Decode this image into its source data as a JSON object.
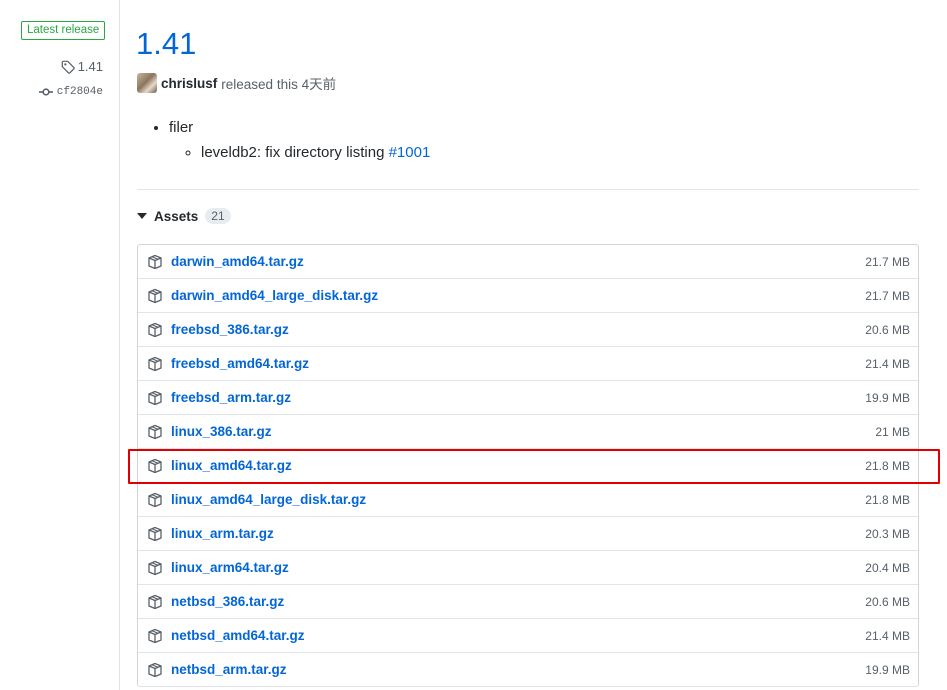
{
  "meta": {
    "latest_badge": "Latest release",
    "tag": "1.41",
    "commit": "cf2804e"
  },
  "release": {
    "title": "1.41",
    "author": "chrislusf",
    "released_text": "released this 4天前"
  },
  "notes": {
    "items": [
      {
        "text": "filer",
        "subitems": [
          {
            "text": "leveldb2: fix directory listing",
            "link": "#1001"
          }
        ]
      }
    ]
  },
  "assets": {
    "label": "Assets",
    "count": "21",
    "items": [
      {
        "name": "darwin_amd64.tar.gz",
        "size": "21.7 MB"
      },
      {
        "name": "darwin_amd64_large_disk.tar.gz",
        "size": "21.7 MB"
      },
      {
        "name": "freebsd_386.tar.gz",
        "size": "20.6 MB"
      },
      {
        "name": "freebsd_amd64.tar.gz",
        "size": "21.4 MB"
      },
      {
        "name": "freebsd_arm.tar.gz",
        "size": "19.9 MB"
      },
      {
        "name": "linux_386.tar.gz",
        "size": "21 MB"
      },
      {
        "name": "linux_amd64.tar.gz",
        "size": "21.8 MB"
      },
      {
        "name": "linux_amd64_large_disk.tar.gz",
        "size": "21.8 MB"
      },
      {
        "name": "linux_arm.tar.gz",
        "size": "20.3 MB"
      },
      {
        "name": "linux_arm64.tar.gz",
        "size": "20.4 MB"
      },
      {
        "name": "netbsd_386.tar.gz",
        "size": "20.6 MB"
      },
      {
        "name": "netbsd_amd64.tar.gz",
        "size": "21.4 MB"
      },
      {
        "name": "netbsd_arm.tar.gz",
        "size": "19.9 MB"
      }
    ]
  },
  "colors": {
    "link": "#0366d6",
    "badge_green": "#28a745",
    "highlight_red": "#e00000"
  },
  "icons": {
    "tag": "tag-icon",
    "commit": "git-commit-icon",
    "asset": "package-icon",
    "expand": "triangle-down-icon"
  }
}
